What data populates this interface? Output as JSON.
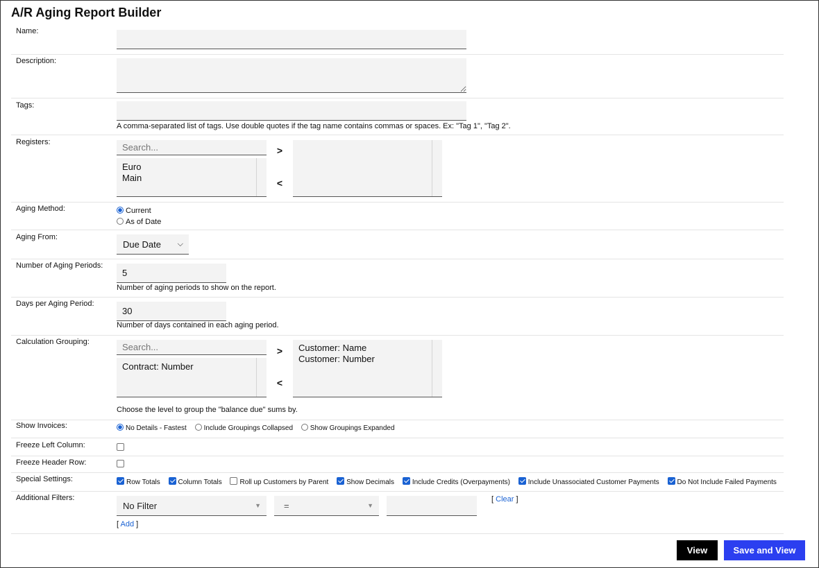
{
  "title": "A/R Aging Report Builder",
  "name": {
    "label": "Name:",
    "value": ""
  },
  "description": {
    "label": "Description:",
    "value": ""
  },
  "tags": {
    "label": "Tags:",
    "value": "",
    "help": "A comma-separated list of tags. Use double quotes if the tag name contains commas or spaces. Ex: \"Tag 1\", \"Tag 2\"."
  },
  "registers": {
    "label": "Registers:",
    "search_placeholder": "Search...",
    "available": [
      "Euro",
      "Main"
    ],
    "selected": []
  },
  "aging_method": {
    "label": "Aging Method:",
    "options": [
      "Current",
      "As of Date"
    ],
    "selected": "Current"
  },
  "aging_from": {
    "label": "Aging From:",
    "value": "Due Date"
  },
  "num_periods": {
    "label": "Number of Aging Periods:",
    "value": "5",
    "help": "Number of aging periods to show on the report."
  },
  "days_per_period": {
    "label": "Days per Aging Period:",
    "value": "30",
    "help": "Number of days contained in each aging period."
  },
  "calc_grouping": {
    "label": "Calculation Grouping:",
    "search_placeholder": "Search...",
    "available": [
      "Contract: Number"
    ],
    "selected": [
      "Customer: Name",
      "Customer: Number"
    ],
    "help": "Choose the level to group the \"balance due\" sums by."
  },
  "show_invoices": {
    "label": "Show Invoices:",
    "options": [
      "No Details - Fastest",
      "Include Groupings Collapsed",
      "Show Groupings Expanded"
    ],
    "selected": "No Details - Fastest"
  },
  "freeze_left": {
    "label": "Freeze Left Column:",
    "checked": false
  },
  "freeze_header": {
    "label": "Freeze Header Row:",
    "checked": false
  },
  "special_settings": {
    "label": "Special Settings:",
    "options": [
      {
        "label": "Row Totals",
        "checked": true
      },
      {
        "label": "Column Totals",
        "checked": true
      },
      {
        "label": "Roll up Customers by Parent",
        "checked": false
      },
      {
        "label": "Show Decimals",
        "checked": true
      },
      {
        "label": "Include Credits (Overpayments)",
        "checked": true
      },
      {
        "label": "Include Unassociated Customer Payments",
        "checked": true
      },
      {
        "label": "Do Not Include Failed Payments",
        "checked": true
      }
    ]
  },
  "additional_filters": {
    "label": "Additional Filters:",
    "field": "No Filter",
    "operator": "=",
    "value": "",
    "clear_label": "Clear",
    "add_label": "Add"
  },
  "buttons": {
    "view": "View",
    "save_and_view": "Save and View"
  },
  "colors": {
    "accent": "#1a62d3",
    "primary_button": "#2b3ff0",
    "dark_button": "#000000"
  }
}
